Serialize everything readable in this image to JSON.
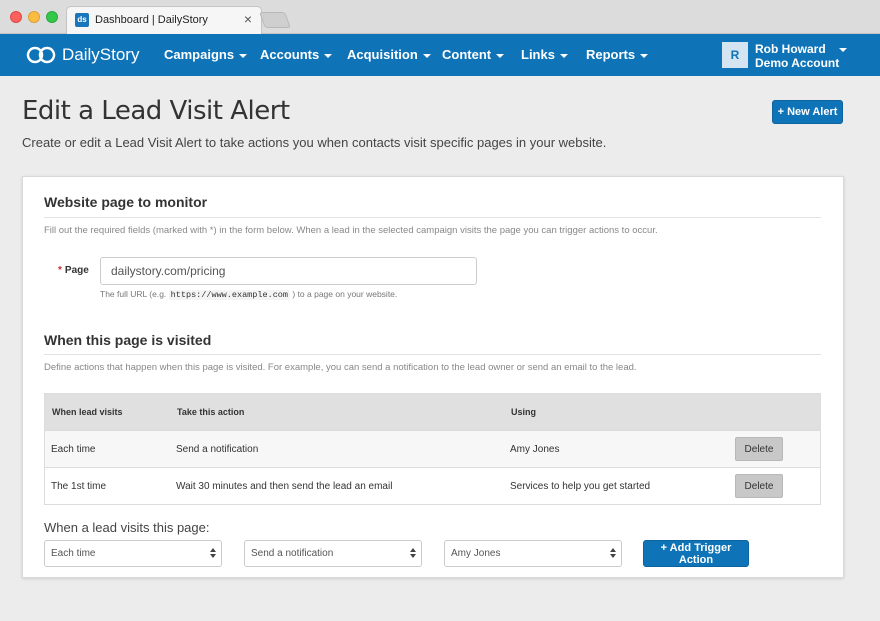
{
  "browser": {
    "tab_favicon": "ds",
    "tab_title": "Dashboard | DailyStory",
    "tab_close": "×"
  },
  "navbar": {
    "brand": "DailyStory",
    "items": [
      "Campaigns",
      "Accounts",
      "Acquisition",
      "Content",
      "Links",
      "Reports"
    ],
    "user": {
      "initial": "R",
      "name": "Rob Howard",
      "account": "Demo Account"
    }
  },
  "header": {
    "title": "Edit a Lead Visit Alert",
    "subtitle": "Create or edit a Lead Visit Alert to take actions you when contacts visit specific pages in your website.",
    "new_alert": "+ New Alert"
  },
  "monitor": {
    "title": "Website page to monitor",
    "help": "Fill out the required fields (marked with *) in the form below. When a lead in the selected campaign visits the page you can trigger actions to occur.",
    "page_label_required": "*",
    "page_label": "Page",
    "page_value": "dailystory.com/pricing",
    "hint_prefix": "The full URL (e.g.",
    "hint_example": "https://www.example.com",
    "hint_suffix": ") to a page on your website."
  },
  "visited": {
    "title": "When this page is visited",
    "help": "Define actions that happen when this page is visited. For example, you can send a notification to the lead owner or send an email to the lead.",
    "columns": [
      "When lead visits",
      "Take this action",
      "Using"
    ],
    "rows": [
      {
        "when": "Each time",
        "action": "Send a notification",
        "using": "Amy Jones",
        "button": "Delete"
      },
      {
        "when": "The 1st time",
        "action": "Wait 30 minutes and then send the lead an email",
        "using": "Services to help you get started",
        "button": "Delete"
      }
    ],
    "trigger_label": "When a lead visits this page:",
    "select_when": "Each time",
    "select_action": "Send a notification",
    "select_using": "Amy Jones",
    "add_trigger": "+ Add Trigger Action"
  },
  "colors": {
    "brand": "#0f73b8",
    "required": "#c9302c"
  },
  "icons": [
    "close-icon",
    "caret-down-icon",
    "select-arrows-icon",
    "logo-infinity-icon"
  ]
}
